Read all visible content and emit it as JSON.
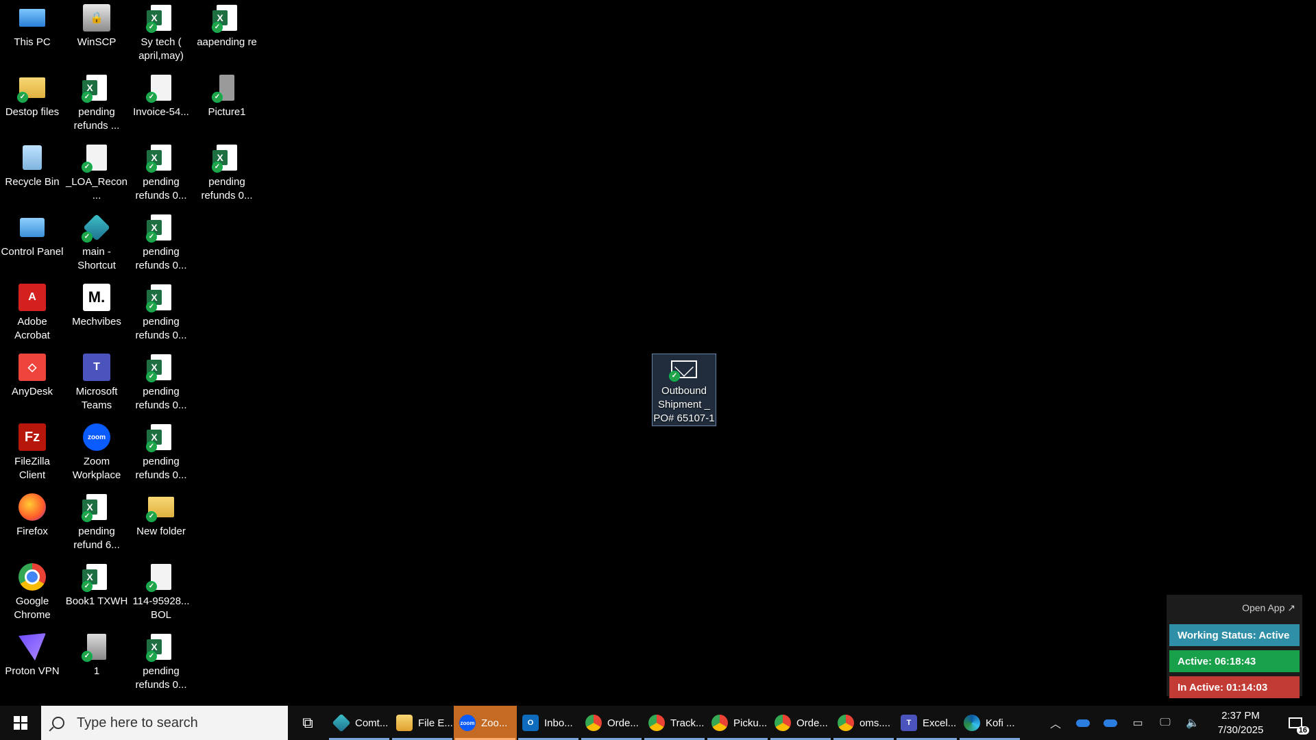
{
  "desktop": {
    "icons": [
      {
        "label": "This PC"
      },
      {
        "label": "WinSCP"
      },
      {
        "label": "Sy tech ( april,may)"
      },
      {
        "label": "aapending re"
      },
      {
        "label": "Destop files"
      },
      {
        "label": "pending refunds ..."
      },
      {
        "label": "Invoice-54..."
      },
      {
        "label": "Picture1"
      },
      {
        "label": "Recycle Bin"
      },
      {
        "label": "_LOA_Recon..."
      },
      {
        "label": "pending refunds 0..."
      },
      {
        "label": "pending refunds 0..."
      },
      {
        "label": "Control Panel"
      },
      {
        "label": "main - Shortcut"
      },
      {
        "label": "pending refunds 0..."
      },
      {
        "label": "Adobe Acrobat"
      },
      {
        "label": "Mechvibes"
      },
      {
        "label": "pending refunds 0..."
      },
      {
        "label": "AnyDesk"
      },
      {
        "label": "Microsoft Teams"
      },
      {
        "label": "pending refunds 0..."
      },
      {
        "label": "FileZilla Client"
      },
      {
        "label": "Zoom Workplace"
      },
      {
        "label": "pending refunds 0..."
      },
      {
        "label": "Firefox"
      },
      {
        "label": "pending refund 6..."
      },
      {
        "label": "New folder"
      },
      {
        "label": "Google Chrome"
      },
      {
        "label": "Book1 TXWH"
      },
      {
        "label": "114-95928... BOL"
      },
      {
        "label": "Proton VPN"
      },
      {
        "label": "1"
      },
      {
        "label": "pending refunds 0..."
      },
      {
        "label": "Outbound Shipment _ PO# 65107-1"
      }
    ],
    "glyphs": {
      "mechvibes": "M.",
      "teams": "T",
      "zoom": "zoom",
      "filezilla": "Fz",
      "acrobat": "A",
      "anydesk": "◇",
      "winscp": "🔒",
      "excel": "X"
    }
  },
  "widget": {
    "open_app": "Open App ↗",
    "working_status": "Working Status: Active",
    "active": "Active: 06:18:43",
    "inactive": "In Active: 01:14:03",
    "colors": {
      "working": "#2f8fa6",
      "active": "#18a04a",
      "inactive": "#c23b35"
    }
  },
  "taskbar": {
    "search_placeholder": "Type here to search",
    "apps": [
      {
        "label": "Comt...",
        "icon": "comt-icon"
      },
      {
        "label": "File E...",
        "icon": "file-explorer-icon"
      },
      {
        "label": "Zoo...",
        "icon": "zoom-icon"
      },
      {
        "label": "Inbo...",
        "icon": "outlook-icon"
      },
      {
        "label": "Orde...",
        "icon": "chrome-icon"
      },
      {
        "label": "Track...",
        "icon": "chrome-icon"
      },
      {
        "label": "Picku...",
        "icon": "chrome-icon"
      },
      {
        "label": "Orde...",
        "icon": "chrome-icon"
      },
      {
        "label": "oms....",
        "icon": "chrome-icon"
      },
      {
        "label": "Excel...",
        "icon": "teams-icon"
      },
      {
        "label": "Kofi ...",
        "icon": "edge-icon"
      }
    ],
    "zoom_glyph": "zoom",
    "outlook_glyph": "O",
    "teams_glyph": "T",
    "clock_time": "2:37 PM",
    "clock_date": "7/30/2025",
    "notification_count": "16"
  }
}
